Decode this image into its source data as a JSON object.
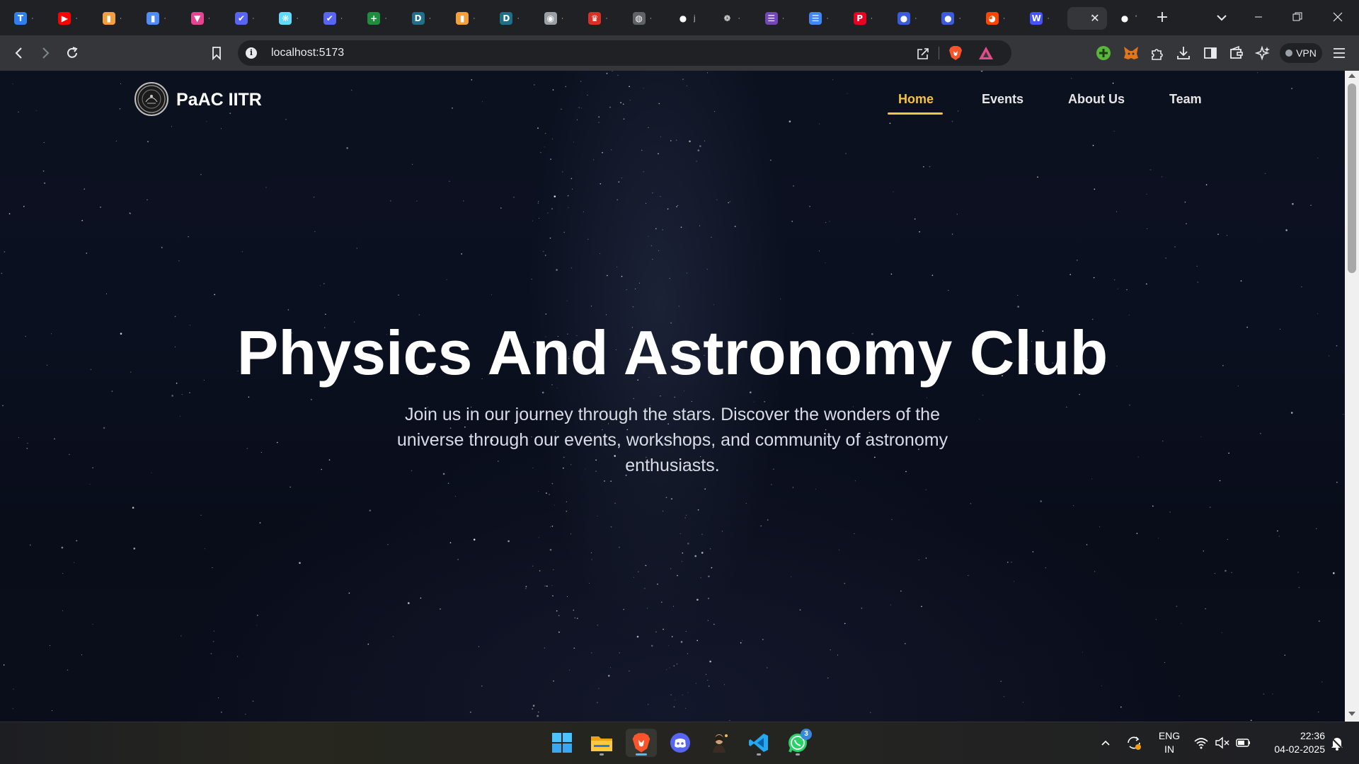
{
  "browser": {
    "tabs": [
      {
        "icon": "tab-favicon-analytics",
        "color": "#2f80ed",
        "glyph": "T",
        "title": "·"
      },
      {
        "icon": "tab-favicon-youtube",
        "color": "#ff0000",
        "glyph": "▶",
        "title": "·"
      },
      {
        "icon": "tab-favicon-bar-chart",
        "color": "#f2a03d",
        "glyph": "▮",
        "title": "·"
      },
      {
        "icon": "tab-favicon-bar-chart-2",
        "color": "#4f8df5",
        "glyph": "▮",
        "title": "·"
      },
      {
        "icon": "tab-favicon-vite",
        "color": "#e84393",
        "glyph": "▼",
        "title": "·"
      },
      {
        "icon": "tab-favicon-tanstack",
        "color": "#5865f2",
        "glyph": "✔",
        "title": "·"
      },
      {
        "icon": "tab-favicon-react",
        "color": "#61dafb",
        "glyph": "❋",
        "title": "·"
      },
      {
        "icon": "tab-favicon-tanstack-2",
        "color": "#5865f2",
        "glyph": "✔",
        "title": "·"
      },
      {
        "icon": "tab-favicon-sheets",
        "color": "#1e8e3e",
        "glyph": "+",
        "title": "·"
      },
      {
        "icon": "tab-favicon-d",
        "color": "#1f6f8b",
        "glyph": "D",
        "title": "·"
      },
      {
        "icon": "tab-favicon-bar-chart-3",
        "color": "#f2a03d",
        "glyph": "▮",
        "title": "·"
      },
      {
        "icon": "tab-favicon-d-2",
        "color": "#1f6f8b",
        "glyph": "D",
        "title": "·"
      },
      {
        "icon": "tab-favicon-circle",
        "color": "#9aa0a6",
        "glyph": "◉",
        "title": "·"
      },
      {
        "icon": "tab-favicon-crown",
        "color": "#d93025",
        "glyph": "♛",
        "title": "·"
      },
      {
        "icon": "tab-favicon-grey",
        "color": "#5f6368",
        "glyph": "◍",
        "title": "·"
      },
      {
        "icon": "tab-favicon-github",
        "color": "#202124",
        "glyph": "●",
        "title": "j"
      },
      {
        "icon": "tab-favicon-chatgpt",
        "color": "#202124",
        "glyph": "❁",
        "title": "·"
      },
      {
        "icon": "tab-favicon-forms",
        "color": "#7248b9",
        "glyph": "☰",
        "title": "·"
      },
      {
        "icon": "tab-favicon-docs",
        "color": "#4285f4",
        "glyph": "☰",
        "title": "·"
      },
      {
        "icon": "tab-favicon-pinterest",
        "color": "#e60023",
        "glyph": "P",
        "title": "·"
      },
      {
        "icon": "tab-favicon-blue",
        "color": "#3b5bdb",
        "glyph": "●",
        "title": "·"
      },
      {
        "icon": "tab-favicon-blue-2",
        "color": "#3b5bdb",
        "glyph": "●",
        "title": "·"
      },
      {
        "icon": "tab-favicon-reddit",
        "color": "#ff4500",
        "glyph": "◕",
        "title": "·"
      },
      {
        "icon": "tab-favicon-webflow",
        "color": "#4353ff",
        "glyph": "W",
        "title": "·"
      },
      {
        "icon": "tab-favicon-current",
        "color": "#35363a",
        "glyph": "",
        "title": "'",
        "active": true
      },
      {
        "icon": "tab-favicon-github-2",
        "color": "#202124",
        "glyph": "●",
        "title": "'"
      }
    ],
    "url": "localhost:5173",
    "vpn_label": "VPN"
  },
  "site": {
    "brand": "PaAC IITR",
    "nav": [
      {
        "label": "Home",
        "active": true
      },
      {
        "label": "Events",
        "active": false
      },
      {
        "label": "About Us",
        "active": false
      },
      {
        "label": "Team",
        "active": false
      }
    ],
    "hero": {
      "title": "Physics And Astronomy Club",
      "subtitle": "Join us in our journey through the stars. Discover the wonders of the universe through our events, workshops, and community of astronomy enthusiasts."
    },
    "accent_color": "#f6c343"
  },
  "taskbar": {
    "apps": [
      {
        "name": "start-button",
        "icon": "windows-icon"
      },
      {
        "name": "file-explorer-button",
        "icon": "folder-icon"
      },
      {
        "name": "brave-browser-button",
        "icon": "brave-icon",
        "active": true
      },
      {
        "name": "discord-button",
        "icon": "discord-icon"
      },
      {
        "name": "photo-app-button",
        "icon": "photo-icon"
      },
      {
        "name": "vscode-button",
        "icon": "vscode-icon"
      },
      {
        "name": "whatsapp-button",
        "icon": "whatsapp-icon",
        "badge": "3"
      }
    ],
    "language": {
      "line1": "ENG",
      "line2": "IN"
    },
    "time": "22:36",
    "date": "04-02-2025"
  }
}
